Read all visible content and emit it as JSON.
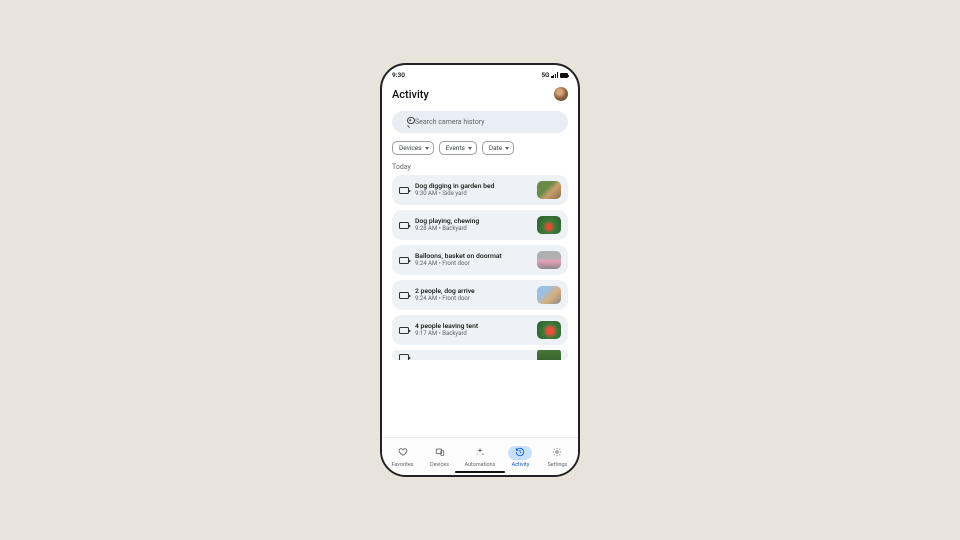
{
  "status": {
    "time": "9:30",
    "network": "5G"
  },
  "header": {
    "title": "Activity"
  },
  "search": {
    "placeholder": "Search camera history"
  },
  "filters": [
    {
      "label": "Devices"
    },
    {
      "label": "Events"
    },
    {
      "label": "Date"
    }
  ],
  "section": {
    "label": "Today"
  },
  "events": [
    {
      "title": "Dog digging in garden bed",
      "time": "9:30 AM",
      "location": "Side yard",
      "thumb": "garden"
    },
    {
      "title": "Dog playing, chewing",
      "time": "9:28 AM",
      "location": "Backyard",
      "thumb": "play"
    },
    {
      "title": "Balloons, basket on doormat",
      "time": "9:24 AM",
      "location": "Front door",
      "thumb": "door"
    },
    {
      "title": "2 people, dog arrive",
      "time": "9:24 AM",
      "location": "Front door",
      "thumb": "people"
    },
    {
      "title": "4 people leaving tent",
      "time": "9:17 AM",
      "location": "Backyard",
      "thumb": "tent"
    }
  ],
  "nav": {
    "items": [
      {
        "label": "Favorites",
        "icon": "heart"
      },
      {
        "label": "Devices",
        "icon": "devices"
      },
      {
        "label": "Automations",
        "icon": "sparkle"
      },
      {
        "label": "Activity",
        "icon": "history"
      },
      {
        "label": "Settings",
        "icon": "gear"
      }
    ],
    "active": 3
  }
}
